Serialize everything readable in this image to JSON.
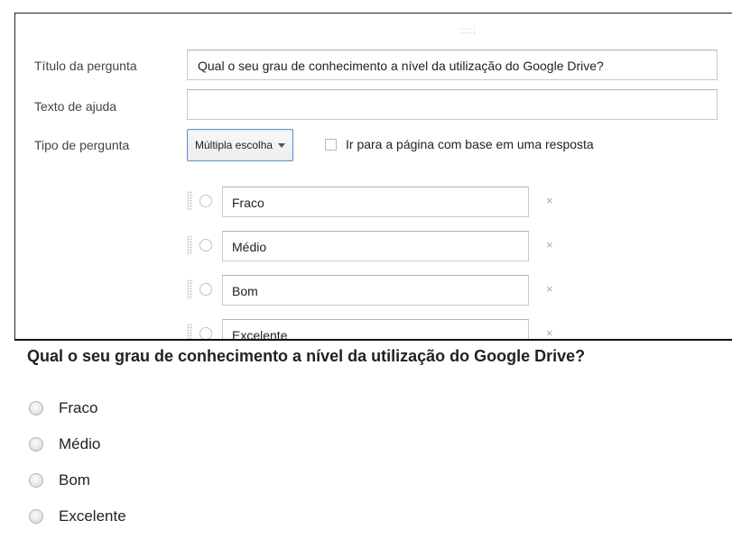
{
  "editor": {
    "drag_handle_glyph": ":::::",
    "question_title_label": "Título da pergunta",
    "question_title_value": "Qual o seu grau de conhecimento a nível da utilização do Google Drive?",
    "help_text_label": "Texto de ajuda",
    "help_text_value": "",
    "question_type_label": "Tipo de pergunta",
    "question_type_value": "Múltipla escolha",
    "page_branch_label": "Ir para a página com base em uma resposta",
    "page_branch_checked": false,
    "options": [
      {
        "value": "Fraco",
        "remove": "×"
      },
      {
        "value": "Médio",
        "remove": "×"
      },
      {
        "value": "Bom",
        "remove": "×"
      },
      {
        "value": "Excelente",
        "remove": "×"
      }
    ]
  },
  "preview": {
    "question": "Qual o seu grau de conhecimento a nível da utilização do Google Drive?",
    "options": [
      "Fraco",
      "Médio",
      "Bom",
      "Excelente"
    ]
  }
}
